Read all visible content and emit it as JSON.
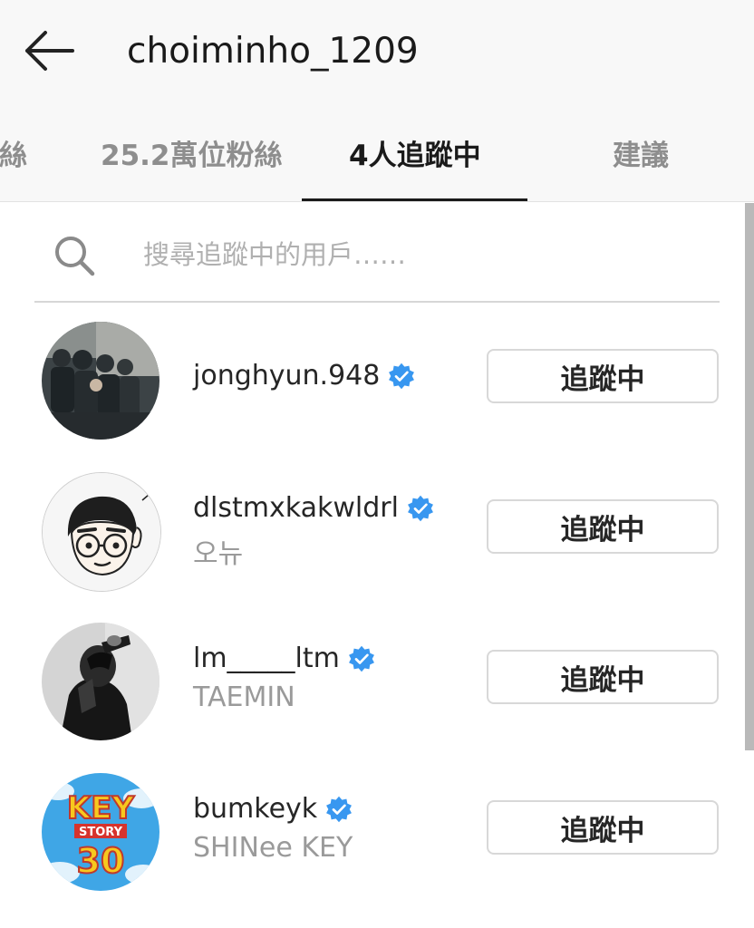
{
  "header": {
    "title": "choiminho_1209",
    "tabs": [
      {
        "label": "粉絲"
      },
      {
        "label": "25.2萬位粉絲"
      },
      {
        "label": "4人追蹤中",
        "active": true
      },
      {
        "label": "建議"
      }
    ]
  },
  "search": {
    "placeholder": "搜尋追蹤中的用戶……"
  },
  "users": [
    {
      "username": "jonghyun.948",
      "full_name": "",
      "verified": true,
      "button_label": "追蹤中"
    },
    {
      "username": "dlstmxkakwldrl",
      "full_name": "오뉴",
      "verified": true,
      "button_label": "追蹤中"
    },
    {
      "username": "lm_____ltm",
      "full_name": "TAEMIN",
      "verified": true,
      "button_label": "追蹤中"
    },
    {
      "username": "bumkeyk",
      "full_name": "SHINee KEY",
      "verified": true,
      "button_label": "追蹤中"
    }
  ],
  "avatar_labels": {
    "key_top": "KEY",
    "key_mid": "STORY",
    "key_num": "30"
  },
  "colors": {
    "verified": "#3897f0",
    "text_primary": "#262626",
    "text_secondary": "#9a9a9a",
    "header_bg": "#f8f8f8"
  },
  "icons": {
    "back": "arrow-left-icon",
    "search": "search-icon",
    "verified": "verified-badge-icon"
  }
}
